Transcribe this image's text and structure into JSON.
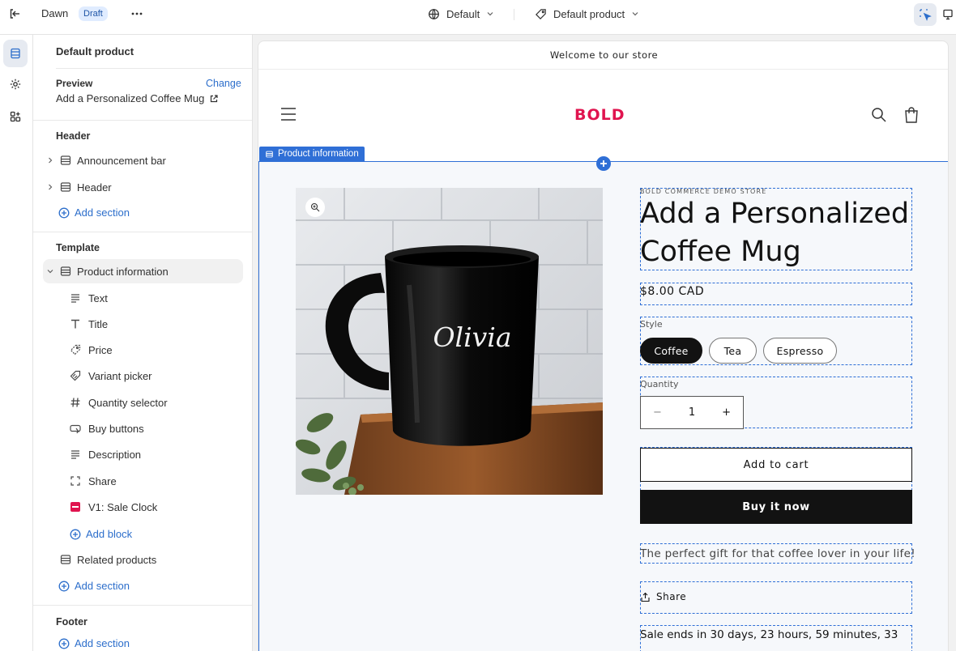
{
  "topbar": {
    "theme_name": "Draft",
    "theme": "Dawn",
    "status_badge": "Draft",
    "store_selector": "Default",
    "template_selector": "Default product"
  },
  "sidebar": {
    "title": "Default product",
    "preview_label": "Preview",
    "preview_change": "Change",
    "preview_product": "Add a Personalized Coffee Mug",
    "header_group": "Header",
    "header_items": [
      "Announcement bar",
      "Header"
    ],
    "add_section": "Add section",
    "template_group": "Template",
    "template_section": "Product information",
    "blocks": [
      "Text",
      "Title",
      "Price",
      "Variant picker",
      "Quantity selector",
      "Buy buttons",
      "Description",
      "Share",
      "V1: Sale Clock"
    ],
    "add_block": "Add block",
    "related": "Related products",
    "footer_group": "Footer"
  },
  "store": {
    "announcement": "Welcome to our store",
    "logo": "BOLD",
    "section_label": "Product information",
    "vendor": "BOLD COMMERCE DEMO STORE",
    "product_title": "Add a Personalized Coffee Mug",
    "price": "$8.00 CAD",
    "style_label": "Style",
    "styles": [
      "Coffee",
      "Tea",
      "Espresso"
    ],
    "selected_style": "Coffee",
    "quantity_label": "Quantity",
    "quantity": "1",
    "add_to_cart": "Add to cart",
    "buy_now": "Buy it now",
    "description": "The perfect gift for that coffee lover in your life!",
    "share": "Share",
    "sale_clock": "Sale ends in 30 days, 23 hours, 59 minutes, 33",
    "mug_text": "Olivia"
  },
  "colors": {
    "accent": "#2f6fd6",
    "brand": "#e0144f",
    "button_dark": "#121212"
  }
}
